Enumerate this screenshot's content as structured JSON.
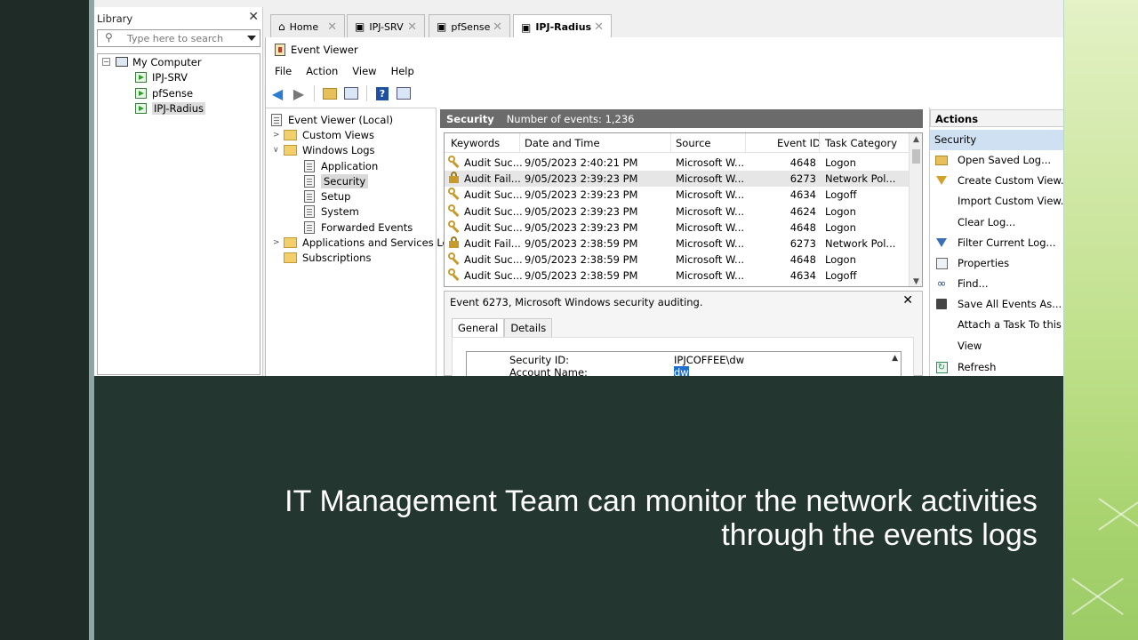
{
  "library": {
    "title": "Library",
    "search_placeholder": "Type here to search",
    "root": "My Computer",
    "vms": [
      "IPJ-SRV",
      "pfSense",
      "IPJ-Radius"
    ]
  },
  "tabs": [
    "Home",
    "IPJ-SRV",
    "pfSense",
    "IPJ-Radius"
  ],
  "app": {
    "title": "Event Viewer",
    "menu": [
      "File",
      "Action",
      "View",
      "Help"
    ]
  },
  "tree": {
    "root": "Event Viewer (Local)",
    "custom_views": "Custom Views",
    "windows_logs": "Windows Logs",
    "logs": [
      "Application",
      "Security",
      "Setup",
      "System",
      "Forwarded Events"
    ],
    "apps_services": "Applications and Services Lo",
    "subscriptions": "Subscriptions"
  },
  "log_header": {
    "name": "Security",
    "count_text": "Number of events: 1,236"
  },
  "grid": {
    "columns": [
      "Keywords",
      "Date and Time",
      "Source",
      "Event ID",
      "Task Category"
    ],
    "rows": [
      {
        "keyword": "Audit Suc...",
        "datetime": "9/05/2023 2:40:21 PM",
        "source": "Microsoft W...",
        "id": "4648",
        "task": "Logon",
        "icon": "key-icon"
      },
      {
        "keyword": "Audit Fail...",
        "datetime": "9/05/2023 2:39:23 PM",
        "source": "Microsoft W...",
        "id": "6273",
        "task": "Network Pol...",
        "icon": "lock-icon"
      },
      {
        "keyword": "Audit Suc...",
        "datetime": "9/05/2023 2:39:23 PM",
        "source": "Microsoft W...",
        "id": "4634",
        "task": "Logoff",
        "icon": "key-icon"
      },
      {
        "keyword": "Audit Suc...",
        "datetime": "9/05/2023 2:39:23 PM",
        "source": "Microsoft W...",
        "id": "4624",
        "task": "Logon",
        "icon": "key-icon"
      },
      {
        "keyword": "Audit Suc...",
        "datetime": "9/05/2023 2:39:23 PM",
        "source": "Microsoft W...",
        "id": "4648",
        "task": "Logon",
        "icon": "key-icon"
      },
      {
        "keyword": "Audit Fail...",
        "datetime": "9/05/2023 2:38:59 PM",
        "source": "Microsoft W...",
        "id": "6273",
        "task": "Network Pol...",
        "icon": "lock-icon"
      },
      {
        "keyword": "Audit Suc...",
        "datetime": "9/05/2023 2:38:59 PM",
        "source": "Microsoft W...",
        "id": "4648",
        "task": "Logon",
        "icon": "key-icon"
      },
      {
        "keyword": "Audit Suc...",
        "datetime": "9/05/2023 2:38:59 PM",
        "source": "Microsoft W...",
        "id": "4634",
        "task": "Logoff",
        "icon": "key-icon"
      }
    ]
  },
  "detail": {
    "title": "Event 6273, Microsoft Windows security auditing.",
    "tabs": [
      "General",
      "Details"
    ],
    "fields": [
      {
        "label": "Security ID:",
        "value": "IPJCOFFEE\\dw"
      },
      {
        "label": "Account Name:",
        "value": "dw"
      }
    ]
  },
  "actions": {
    "title": "Actions",
    "section": "Security",
    "items": [
      {
        "label": "Open Saved Log...",
        "icon": "folder-icon"
      },
      {
        "label": "Create Custom View...",
        "icon": "filter-icon"
      },
      {
        "label": "Import Custom View...",
        "icon": ""
      },
      {
        "label": "Clear Log...",
        "icon": ""
      },
      {
        "label": "Filter Current Log...",
        "icon": "filter-icon"
      },
      {
        "label": "Properties",
        "icon": "properties-icon"
      },
      {
        "label": "Find...",
        "icon": "binoculars-icon"
      },
      {
        "label": "Save All Events As...",
        "icon": "save-icon"
      },
      {
        "label": "Attach a Task To this Log...",
        "icon": ""
      },
      {
        "label": "View",
        "icon": ""
      },
      {
        "label": "Refresh",
        "icon": "refresh-icon"
      }
    ]
  },
  "caption": {
    "line1": "IT Management Team can monitor the network activities",
    "line2": "through the events logs"
  },
  "colors": {
    "slide_bg": "#243630",
    "accent_green": "#a9d470",
    "selection": "#cfe0f2"
  }
}
